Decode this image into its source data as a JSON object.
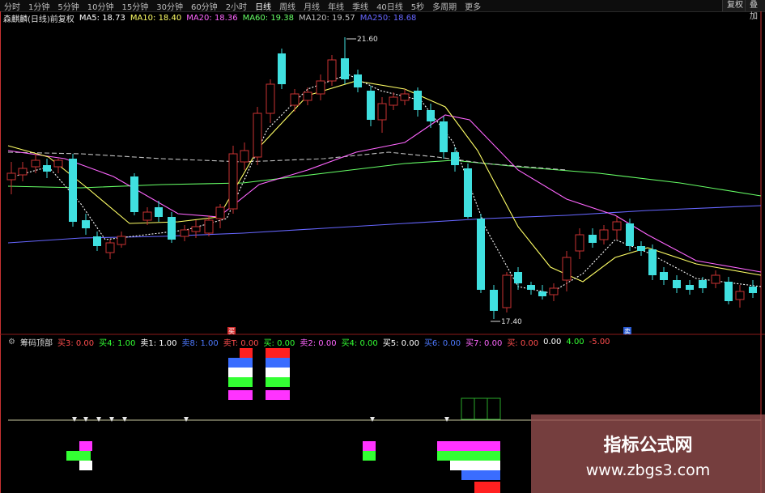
{
  "toolbar": {
    "items": [
      "分时",
      "1分钟",
      "5分钟",
      "10分钟",
      "15分钟",
      "30分钟",
      "60分钟",
      "2小时",
      "日线",
      "周线",
      "月线",
      "年线",
      "季线",
      "40日线",
      "5秒",
      "多周期",
      "更多"
    ],
    "right_buttons": [
      "复权",
      "叠加"
    ]
  },
  "main_legend": {
    "title": "森麒麟(日线)前复权",
    "ma5": "MA5: 18.73",
    "ma10": "MA10: 18.40",
    "ma20": "MA20: 18.36",
    "ma60": "MA60: 19.38",
    "ma120": "MA120: 19.57",
    "ma250": "MA250: 18.68",
    "colors": {
      "ma5": "#ffffff",
      "ma10": "#ffff66",
      "ma20": "#ff66ff",
      "ma60": "#66ff66",
      "ma120": "#c0c0c0",
      "ma250": "#6666ff"
    }
  },
  "main_chart": {
    "high_label": "21.60",
    "low_label": "17.40",
    "marker_red": "买",
    "marker_blue": "卖"
  },
  "indicator_legend": {
    "title": "筹码顶部",
    "items": [
      {
        "text": "买3: 0.00",
        "color": "#ff4d4d"
      },
      {
        "text": "买4: 1.00",
        "color": "#33ff33"
      },
      {
        "text": "卖1: 1.00",
        "color": "#ffffff"
      },
      {
        "text": "卖8: 1.00",
        "color": "#4d79ff"
      },
      {
        "text": "卖T: 0.00",
        "color": "#ff4d4d"
      },
      {
        "text": "买: 0.00",
        "color": "#33ff33"
      },
      {
        "text": "卖2: 0.00",
        "color": "#ff66ff"
      },
      {
        "text": "买4: 0.00",
        "color": "#33ff33"
      },
      {
        "text": "买5: 0.00",
        "color": "#ffffff"
      },
      {
        "text": "买6: 0.00",
        "color": "#4d79ff"
      },
      {
        "text": "买7: 0.00",
        "color": "#ff66ff"
      },
      {
        "text": "买: 0.00",
        "color": "#ff4d4d"
      },
      {
        "text": "0.00",
        "color": "#ffffff"
      },
      {
        "text": "4.00",
        "color": "#33ff33"
      },
      {
        "text": "-5.00",
        "color": "#ff4d4d"
      }
    ]
  },
  "watermark": {
    "title": "指标公式网",
    "url": "www.zbgs3.com"
  }
}
